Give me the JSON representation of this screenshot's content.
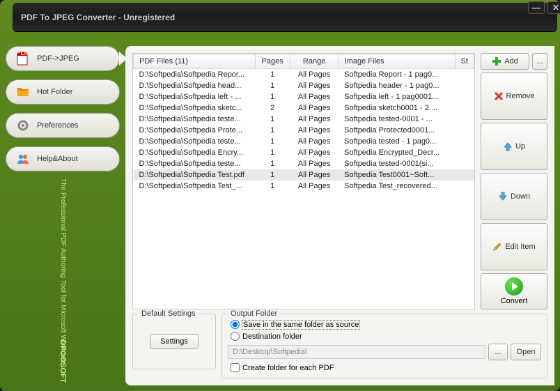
{
  "title": "PDF To JPEG Converter - Unregistered",
  "nav": {
    "pdf_jpeg": "PDF->JPEG",
    "hot_folder": "Hot Folder",
    "preferences": "Preferences",
    "help_about": "Help&About"
  },
  "tagline": "The Professional PDF Authoring Tool\nfor Microsoft Windows",
  "brand": "OPOOSOFT",
  "table": {
    "headers": {
      "files": "PDF Files (11)",
      "pages": "Pages",
      "range": "Range",
      "image": "Image Files",
      "status": "St"
    },
    "rows": [
      {
        "file": "D:\\Softpedia\\Softpedia Repor...",
        "pages": "1",
        "range": "All Pages",
        "image": "Softpedia Report - 1 pag0...",
        "selected": false
      },
      {
        "file": "D:\\Softpedia\\Softpedia head...",
        "pages": "1",
        "range": "All Pages",
        "image": "Softpedia header - 1 pag0...",
        "selected": false
      },
      {
        "file": "D:\\Softpedia\\Softpedia left - ...",
        "pages": "1",
        "range": "All Pages",
        "image": "Softpedia left - 1 pag0001...",
        "selected": false
      },
      {
        "file": "D:\\Softpedia\\Softpedia sketc...",
        "pages": "2",
        "range": "All Pages",
        "image": "Softpedia sketch0001 - 2 ...",
        "selected": false
      },
      {
        "file": "D:\\Softpedia\\Softpedia teste...",
        "pages": "1",
        "range": "All Pages",
        "image": "Softpedia tested-0001 - ...",
        "selected": false
      },
      {
        "file": "D:\\Softpedia\\Softpedia Prote...",
        "pages": "1",
        "range": "All Pages",
        "image": " Softpedia Protected0001...",
        "selected": false
      },
      {
        "file": "D:\\Softpedia\\Softpedia teste...",
        "pages": "1",
        "range": "All Pages",
        "image": "Softpedia tested - 1 pag0...",
        "selected": false
      },
      {
        "file": "D:\\Softpedia\\Softpedia Encry...",
        "pages": "1",
        "range": "All Pages",
        "image": "Softpedia Encrypted_Decr...",
        "selected": false
      },
      {
        "file": "D:\\Softpedia\\Softpedia teste...",
        "pages": "1",
        "range": "All Pages",
        "image": "Softpedia tested-0001(si...",
        "selected": false
      },
      {
        "file": "D:\\Softpedia\\Softpedia Test.pdf",
        "pages": "1",
        "range": "All Pages",
        "image": "Softpedia Test0001~Soft...",
        "selected": true
      },
      {
        "file": "D:\\Softpedia\\Softpedia Test_...",
        "pages": "1",
        "range": "All Pages",
        "image": "Softpedia Test_recovered...",
        "selected": false
      }
    ]
  },
  "actions": {
    "add": "Add",
    "browse": "...",
    "remove": "Remove",
    "up": "Up",
    "down": "Down",
    "edit": "Edit Item",
    "convert": "Convert"
  },
  "default_settings": {
    "title": "Default Settings",
    "button": "Settings"
  },
  "output": {
    "title": "Output Folder",
    "same_folder": "Save in the same folder as source",
    "dest_folder": "Destination folder",
    "dest_path": "D:\\Desktop\\Softpedia\\",
    "browse": "...",
    "open": "Open",
    "create_folder": "Create folder for each PDF"
  }
}
